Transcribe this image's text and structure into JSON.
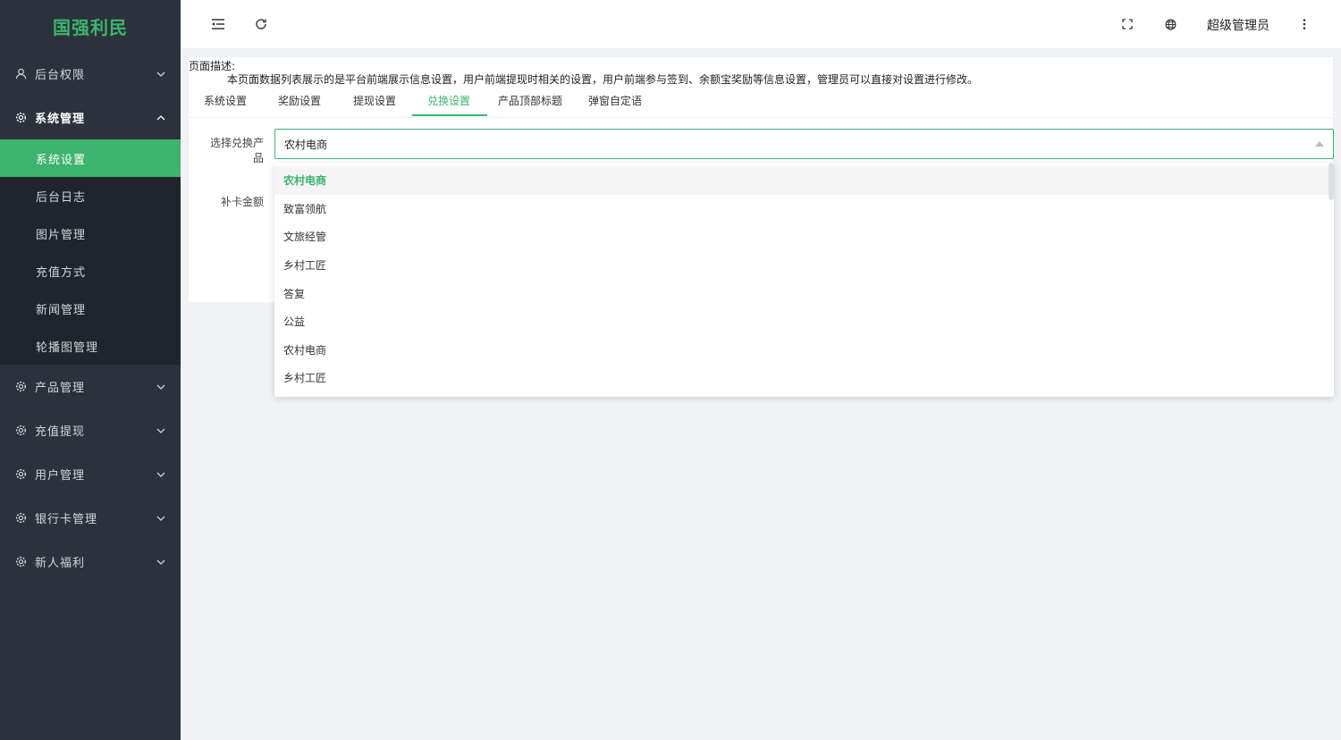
{
  "app": {
    "logo": "国强利民"
  },
  "sidebar": {
    "items": [
      {
        "label": "后台权限",
        "icon": "user-icon",
        "open": false
      },
      {
        "label": "系统管理",
        "icon": "gear-icon",
        "open": true,
        "children": [
          {
            "label": "系统设置",
            "active": true
          },
          {
            "label": "后台日志"
          },
          {
            "label": "图片管理"
          },
          {
            "label": "充值方式"
          },
          {
            "label": "新闻管理"
          },
          {
            "label": "轮播图管理"
          }
        ]
      },
      {
        "label": "产品管理",
        "icon": "gear-icon",
        "open": false
      },
      {
        "label": "充值提现",
        "icon": "gear-icon",
        "open": false
      },
      {
        "label": "用户管理",
        "icon": "gear-icon",
        "open": false
      },
      {
        "label": "银行卡管理",
        "icon": "gear-icon",
        "open": false
      },
      {
        "label": "新人福利",
        "icon": "gear-icon",
        "open": false
      }
    ]
  },
  "header": {
    "user_name": "超级管理员",
    "icons": [
      "menu-fold-icon",
      "refresh-icon",
      "fullscreen-icon",
      "globe-icon",
      "more-vertical-icon"
    ]
  },
  "page": {
    "desc_title": "页面描述:",
    "desc_text": "本页面数据列表展示的是平台前端展示信息设置，用户前端提现时相关的设置，用户前端参与签到、余额宝奖励等信息设置，管理员可以直接对设置进行修改。",
    "tabs": [
      "系统设置",
      "奖励设置",
      "提现设置",
      "兑换设置",
      "产品顶部标题",
      "弹窗自定语"
    ],
    "active_tab": "兑换设置"
  },
  "form": {
    "product_label": "选择兑换产品",
    "product_value": "农村电商",
    "amount_label": "补卡金额"
  },
  "dropdown": {
    "options": [
      "农村电商",
      "致富领航",
      "文旅经管",
      "乡村工匠",
      "答复",
      "公益",
      "农村电商",
      "乡村工匠"
    ],
    "selected_index": 0
  },
  "colors": {
    "accent": "#3cb46e",
    "sidebar_bg": "#2b323b",
    "submenu_bg": "#1f252c"
  }
}
